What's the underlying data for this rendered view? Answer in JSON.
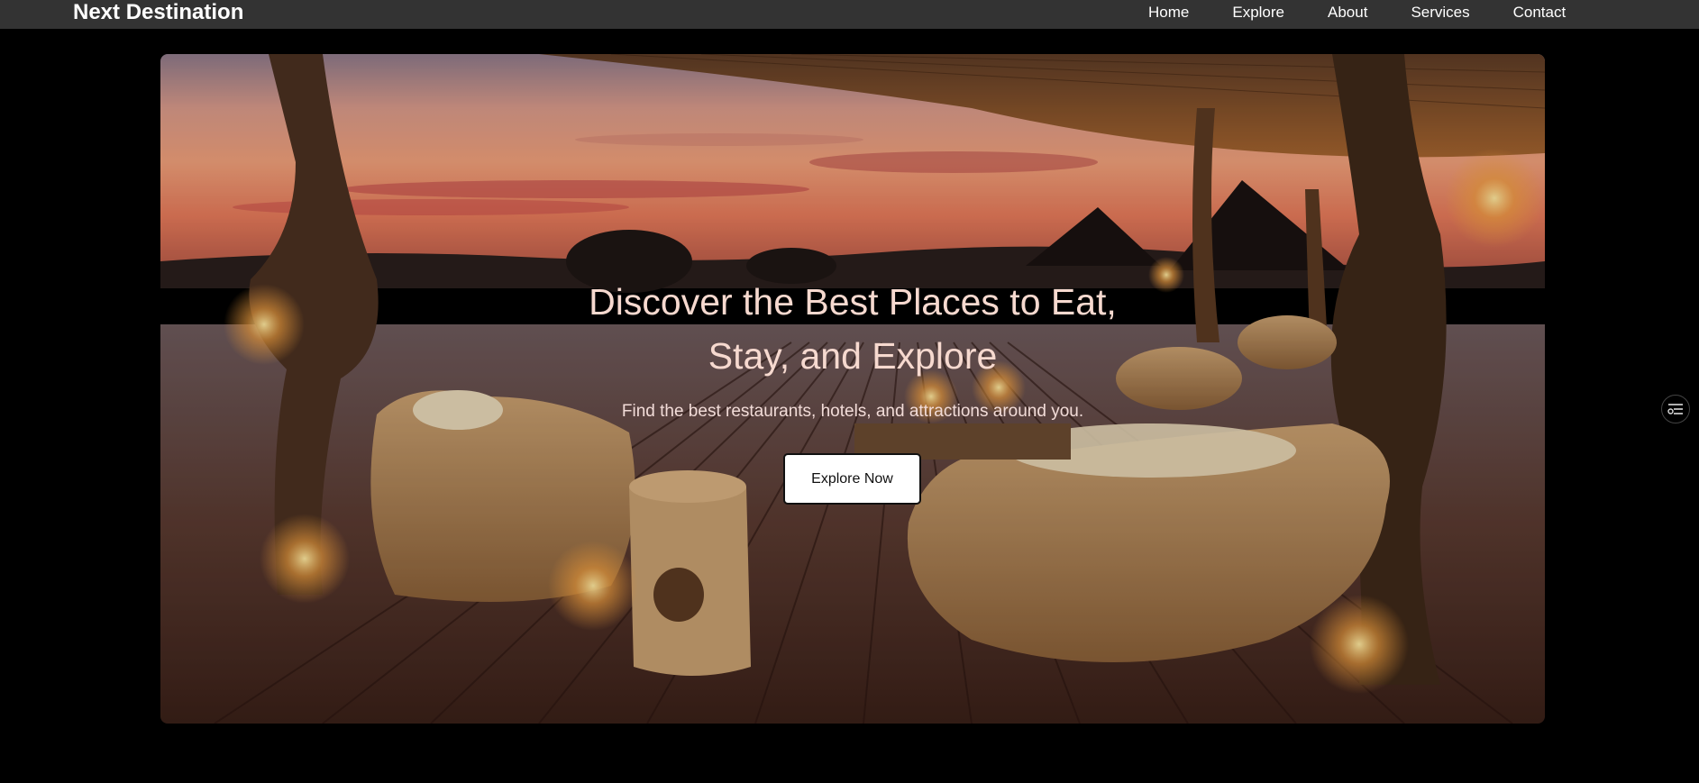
{
  "nav": {
    "brand": "Next Destination",
    "links": [
      {
        "label": "Home"
      },
      {
        "label": "Explore"
      },
      {
        "label": "About"
      },
      {
        "label": "Services"
      },
      {
        "label": "Contact"
      }
    ]
  },
  "hero": {
    "title": "Discover the Best Places to Eat, Stay, and Explore",
    "subtitle": "Find the best restaurants, hotels, and attractions around you.",
    "cta_label": "Explore Now",
    "background": "sunset-safari-lodge-deck-photo"
  },
  "side_widget": {
    "icon": "filter-settings-icon"
  },
  "colors": {
    "navbar_bg": "#333333",
    "page_bg": "#000000",
    "title_text": "#f6d9cf",
    "button_bg": "#ffffff"
  }
}
